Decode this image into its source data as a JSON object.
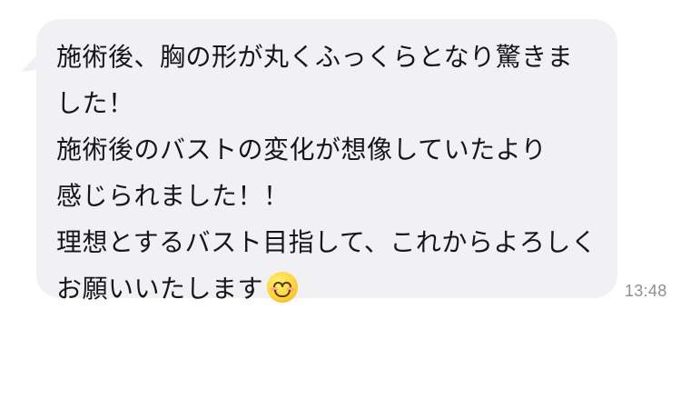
{
  "message": {
    "lines": [
      "施術後、胸の形が丸くふっくらとなり驚きま",
      "した！",
      "施術後のバストの変化が想像していたより",
      "感じられました！！",
      "理想とするバスト目指して、これからよろしく",
      "お願いいたします"
    ],
    "emoji_icon": "smiling-face-icon",
    "timestamp": "13:48"
  },
  "colors": {
    "bubble_background": "#f1f1f3",
    "text": "#161616",
    "timestamp": "#8e8e93"
  }
}
